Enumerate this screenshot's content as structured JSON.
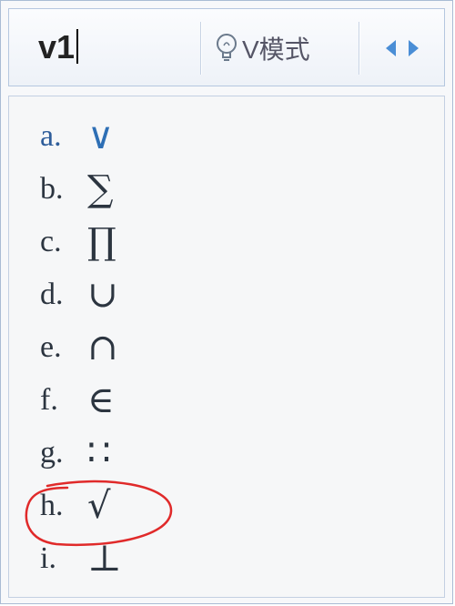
{
  "input_bar": {
    "composition": "v1",
    "mode_label": "V模式",
    "mode_icon": "lightbulb-icon"
  },
  "candidates": [
    {
      "key": "a.",
      "symbol": "∨"
    },
    {
      "key": "b.",
      "symbol": "∑"
    },
    {
      "key": "c.",
      "symbol": "∏"
    },
    {
      "key": "d.",
      "symbol": "∪"
    },
    {
      "key": "e.",
      "symbol": "∩"
    },
    {
      "key": "f.",
      "symbol": "∈"
    },
    {
      "key": "g.",
      "symbol": "∷"
    },
    {
      "key": "h.",
      "symbol": "√"
    },
    {
      "key": "i.",
      "symbol": "⊥"
    }
  ],
  "colors": {
    "accent": "#4a8ed6",
    "annotation": "#e02a2a"
  }
}
